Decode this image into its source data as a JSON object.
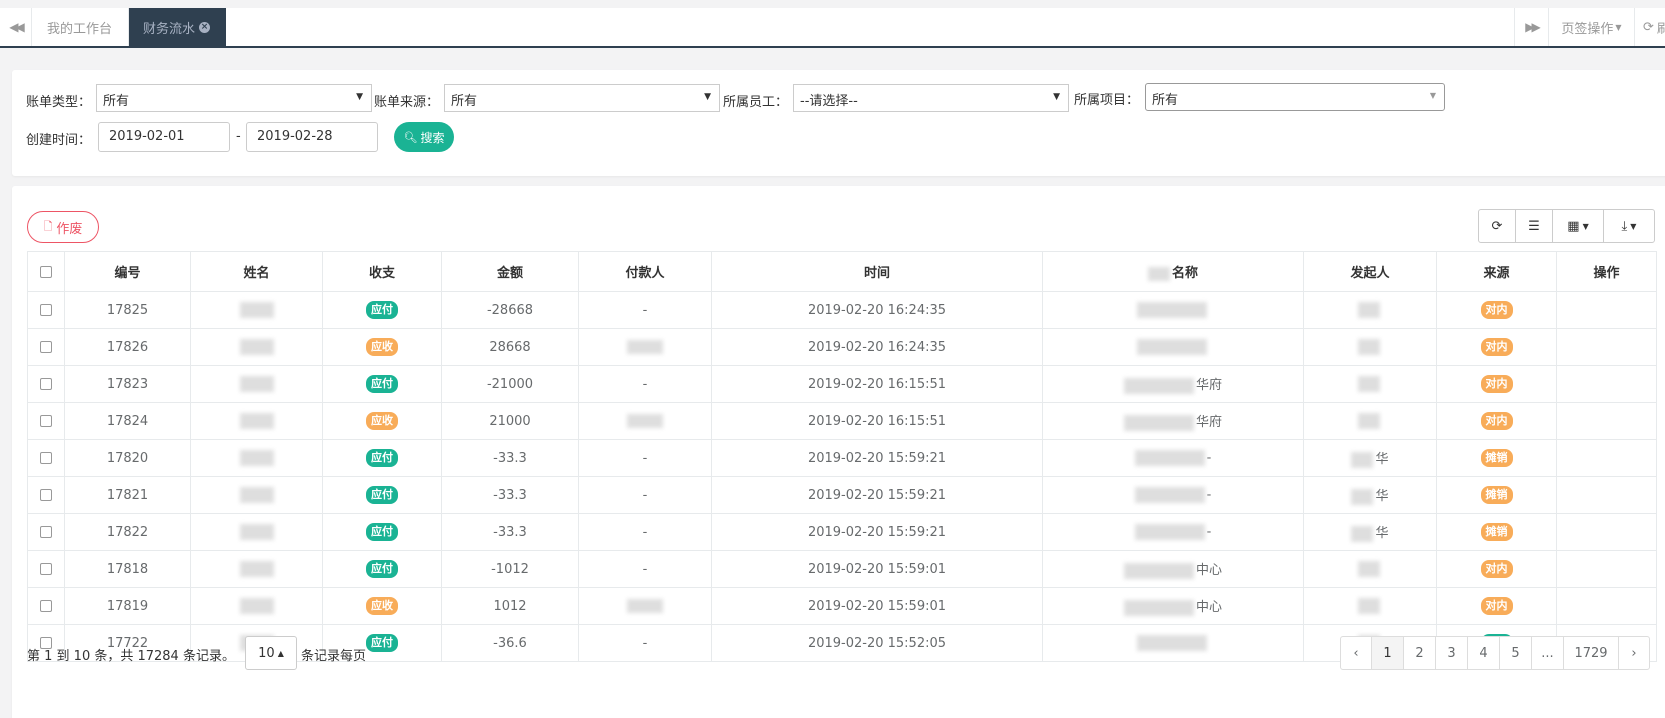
{
  "tabs": {
    "items": [
      {
        "label": "我的工作台"
      },
      {
        "label": "财务流水"
      }
    ],
    "ops_label": "页签操作",
    "refresh_label": "刷"
  },
  "filters": {
    "bill_type_label": "账单类型：",
    "bill_type_value": "所有",
    "bill_source_label": "账单来源：",
    "bill_source_value": "所有",
    "employee_label": "所属员工：",
    "employee_value": "--请选择--",
    "project_label": "所属项目：",
    "project_value": "所有",
    "created_label": "创建时间：",
    "date_from": "2019-02-01",
    "date_sep": "-",
    "date_to": "2019-02-28",
    "search_label": "搜索"
  },
  "actions": {
    "void_label": "作废"
  },
  "table": {
    "headers": {
      "id": "编号",
      "name": "姓名",
      "type": "收支",
      "amount": "金额",
      "payer": "付款人",
      "time": "时间",
      "title": "名称",
      "initiator": "发起人",
      "source": "来源",
      "ops": "操作"
    },
    "rows": [
      {
        "id": "17825",
        "type": "应付",
        "amount": "-28668",
        "payer": "-",
        "time": "2019-02-20 16:24:35",
        "title": "",
        "initiator": "",
        "source": "对内"
      },
      {
        "id": "17826",
        "type": "应收",
        "amount": "28668",
        "payer": "",
        "time": "2019-02-20 16:24:35",
        "title": "",
        "initiator": "",
        "source": "对内"
      },
      {
        "id": "17823",
        "type": "应付",
        "amount": "-21000",
        "payer": "-",
        "time": "2019-02-20 16:15:51",
        "title": "华府",
        "initiator": "",
        "source": "对内"
      },
      {
        "id": "17824",
        "type": "应收",
        "amount": "21000",
        "payer": "",
        "time": "2019-02-20 16:15:51",
        "title": "华府",
        "initiator": "",
        "source": "对内"
      },
      {
        "id": "17820",
        "type": "应付",
        "amount": "-33.3",
        "payer": "-",
        "time": "2019-02-20 15:59:21",
        "title": "-",
        "initiator": "华",
        "source": "摊销"
      },
      {
        "id": "17821",
        "type": "应付",
        "amount": "-33.3",
        "payer": "-",
        "time": "2019-02-20 15:59:21",
        "title": "-",
        "initiator": "华",
        "source": "摊销"
      },
      {
        "id": "17822",
        "type": "应付",
        "amount": "-33.3",
        "payer": "-",
        "time": "2019-02-20 15:59:21",
        "title": "-",
        "initiator": "华",
        "source": "摊销"
      },
      {
        "id": "17818",
        "type": "应付",
        "amount": "-1012",
        "payer": "-",
        "time": "2019-02-20 15:59:01",
        "title": "中心",
        "initiator": "",
        "source": "对内"
      },
      {
        "id": "17819",
        "type": "应收",
        "amount": "1012",
        "payer": "",
        "time": "2019-02-20 15:59:01",
        "title": "中心",
        "initiator": "",
        "source": "对内"
      },
      {
        "id": "17722",
        "type": "应付",
        "amount": "-36.6",
        "payer": "-",
        "time": "2019-02-20 15:52:05",
        "title": "",
        "initiator": "",
        "source": "生产"
      }
    ]
  },
  "pagination": {
    "info": "第 1 到 10 条，共 17284 条记录。",
    "page_size": "10",
    "page_size_suffix": "条记录每页",
    "prev": "‹",
    "next": "›",
    "pages": [
      "1",
      "2",
      "3",
      "4",
      "5",
      "...",
      "1729"
    ]
  },
  "colors": {
    "green": "#1ab394",
    "orange": "#f8ac59",
    "red": "#ed5565",
    "navy": "#2f4050"
  }
}
